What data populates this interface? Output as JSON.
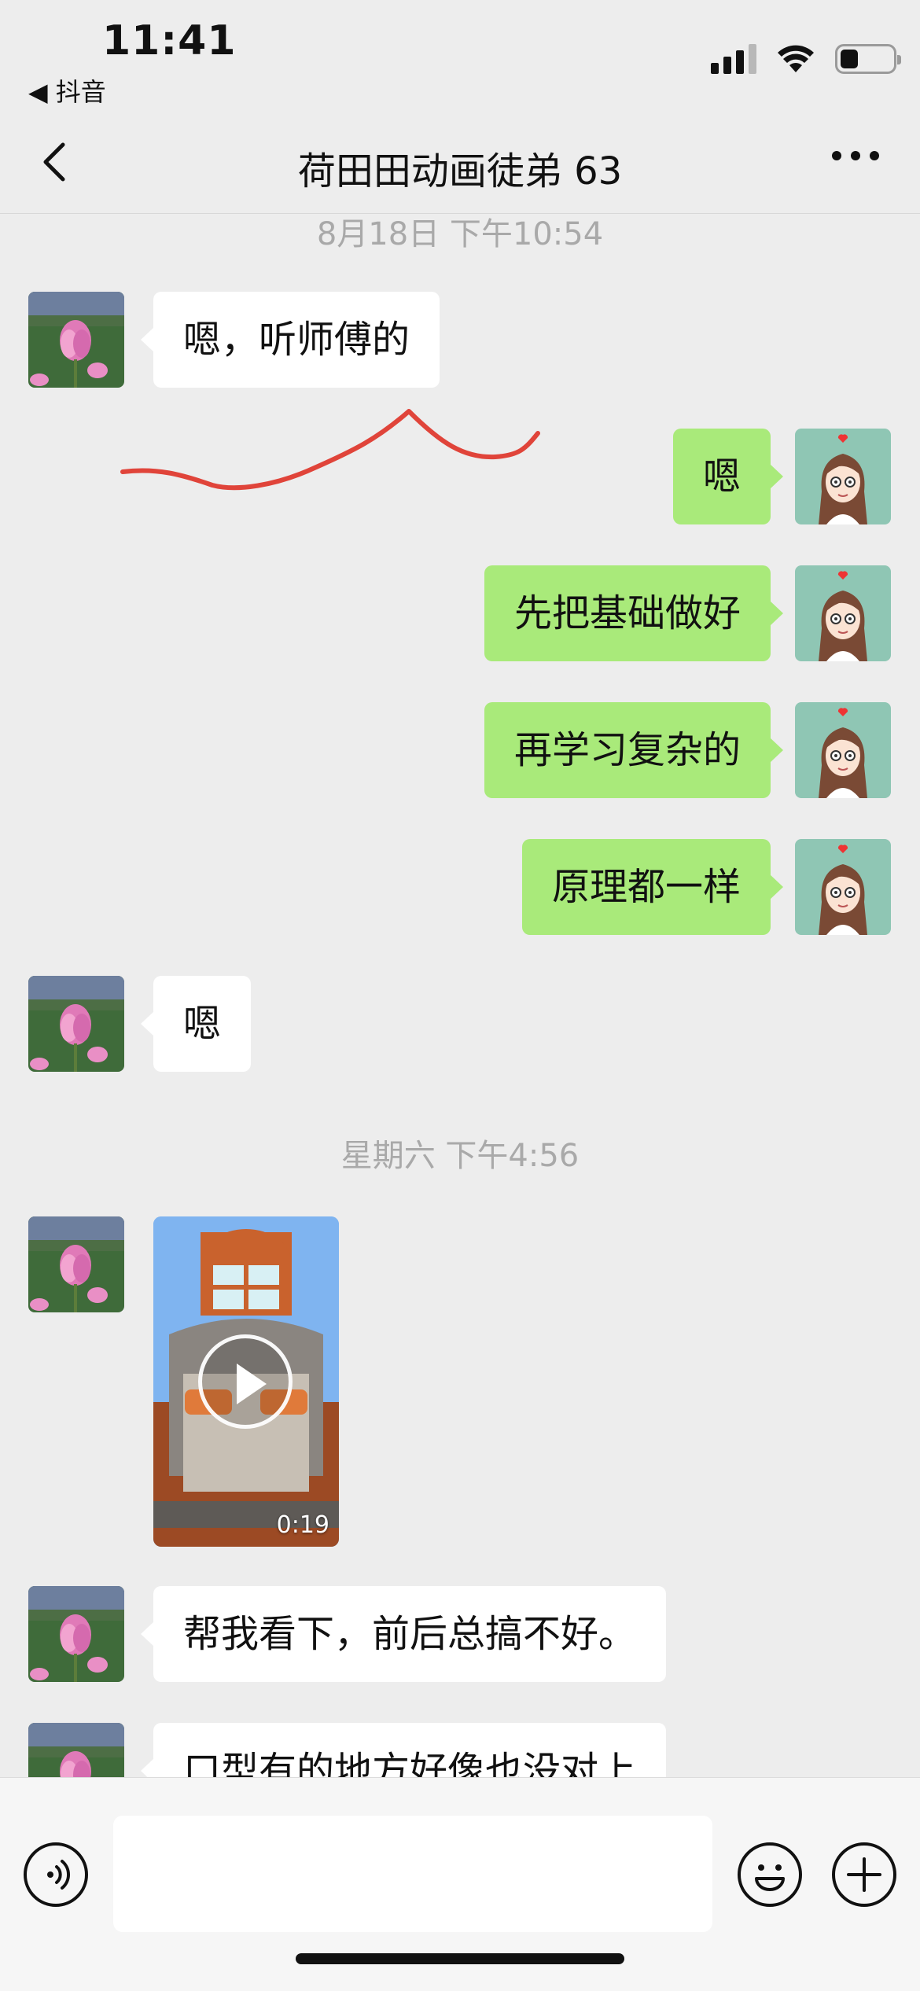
{
  "status_bar": {
    "time": "11:41",
    "back_app": "◀ 抖音",
    "icons": [
      "signal-icon",
      "wifi-icon",
      "battery-icon"
    ]
  },
  "nav": {
    "title": "荷田田动画徒弟 63",
    "back_icon": "chevron-left-icon",
    "more_icon": "more-icon"
  },
  "timestamps": [
    "8月18日 下午10:54",
    "星期六 下午4:56"
  ],
  "messages": [
    {
      "from": "contact",
      "text": "嗯，听师傅的"
    },
    {
      "from": "me",
      "text": "嗯"
    },
    {
      "from": "me",
      "text": "先把基础做好"
    },
    {
      "from": "me",
      "text": "再学习复杂的"
    },
    {
      "from": "me",
      "text": "原理都一样"
    },
    {
      "from": "contact",
      "text": "嗯"
    },
    {
      "from": "contact",
      "type": "video",
      "duration": "0:19"
    },
    {
      "from": "contact",
      "text": "帮我看下，前后总搞不好。"
    },
    {
      "from": "contact",
      "text": "口型有的地方好像也没对上"
    }
  ],
  "colors": {
    "background": "#ededed",
    "incoming_bubble": "#ffffff",
    "outgoing_bubble": "#a9ea7a",
    "annotation_stroke": "#e0443a"
  },
  "input_bar": {
    "voice_icon": "voice-icon",
    "emoji_icon": "emoji-icon",
    "plus_icon": "plus-icon"
  }
}
